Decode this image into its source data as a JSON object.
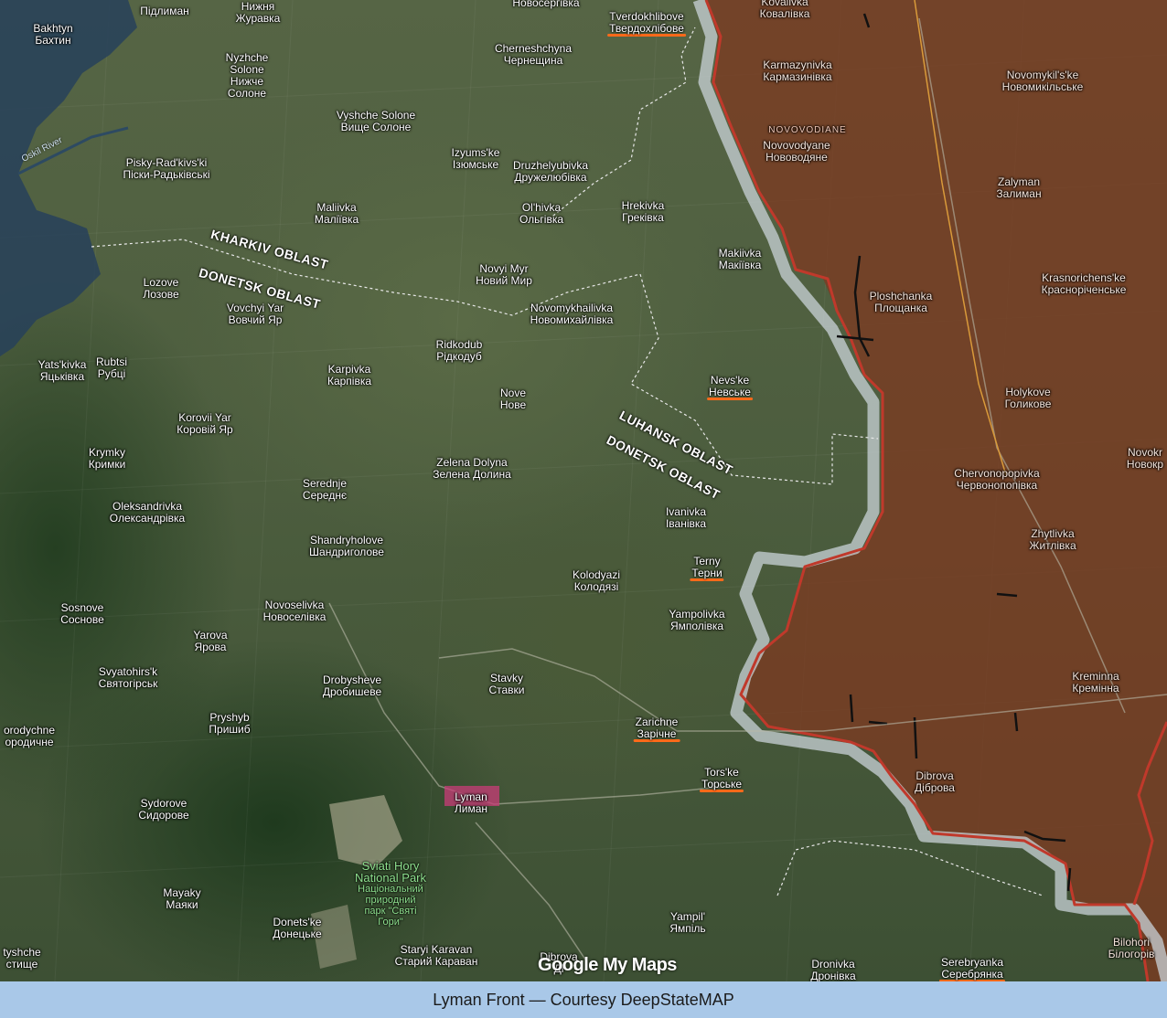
{
  "caption": "Lyman Front — Courtesy DeepStateMAP",
  "watermark": "Google My Maps",
  "colors": {
    "occupied_fill": "#7a3b22",
    "frontline": "#c0392b",
    "grey_zone": "#c9d3d8",
    "front_marker": "#ff6a1a",
    "caption_bg": "#a9c8e8"
  },
  "oblast_labels": {
    "kharkiv": "KHARKIV OBLAST",
    "donetsk_north": "DONETSK OBLAST",
    "luhansk": "LUHANSK OBLAST",
    "donetsk_east": "DONETSK OBLAST"
  },
  "river": "Oskil River",
  "park": {
    "name_en_1": "Sviati Hory",
    "name_en_2": "National Park",
    "name_uk_1": "Національний",
    "name_uk_2": "природний",
    "name_uk_3": "парк \"Святі",
    "name_uk_4": "Гори\""
  },
  "occupied_region_label": "NOVOVODIANE",
  "places": {
    "bakhtyn": {
      "en": "Bakhtyn",
      "uk": "Бахтин"
    },
    "pidlyman": {
      "en": "",
      "uk": "Підлиман"
    },
    "nyzhnia_zhuravka": {
      "en": "Нижня",
      "uk": "Журавка"
    },
    "novoserhivka": {
      "en": "Новосергівка",
      "uk": ""
    },
    "tverdokhlibove": {
      "en": "Tverdokhlibove",
      "uk": "Твердохлібове"
    },
    "kovalivka": {
      "en": "Kovalivka",
      "uk": "Ковалівка"
    },
    "nyzhche_solone": {
      "en": "Nyzhche Solone",
      "uk": "Нижче Солоне"
    },
    "cherneshchyna": {
      "en": "Cherneshchyna",
      "uk": "Чернещина"
    },
    "karmazynivka": {
      "en": "Karmazynivka",
      "uk": "Кармазинівка"
    },
    "novomykilske": {
      "en": "Novomykil's'ke",
      "uk": "Новомикільське"
    },
    "vyshche_solone": {
      "en": "Vyshche Solone",
      "uk": "Вище Солоне"
    },
    "novovodyane": {
      "en": "Novovodyane",
      "uk": "Нововодяне"
    },
    "pisky": {
      "en": "Pisky-Rad'kivs'ki",
      "uk": "Піски-Радьківські"
    },
    "izyumske": {
      "en": "Izyums'ke",
      "uk": "Ізюмське"
    },
    "druzhelyubivka": {
      "en": "Druzhelyubivka",
      "uk": "Дружелюбівка"
    },
    "zalyman": {
      "en": "Zalyman",
      "uk": "Залиман"
    },
    "maliivka": {
      "en": "Maliivka",
      "uk": "Маліївка"
    },
    "olhivka": {
      "en": "Ol'hivka",
      "uk": "Ольгівка"
    },
    "hrekivka": {
      "en": "Hrekivka",
      "uk": "Греківка"
    },
    "makiivka": {
      "en": "Makiivka",
      "uk": "Макіївка"
    },
    "lozove": {
      "en": "Lozove",
      "uk": "Лозове"
    },
    "novyi_myr": {
      "en": "Novyi Myr",
      "uk": "Новий Мир"
    },
    "krasnorichenske": {
      "en": "Krasnorichens'ke",
      "uk": "Красноріченське"
    },
    "ploshchanka": {
      "en": "Ploshchanka",
      "uk": "Площанка"
    },
    "vovchyi_yar": {
      "en": "Vovchyi Yar",
      "uk": "Вовчий Яр"
    },
    "novomykhailivka": {
      "en": "Novomykhailivka",
      "uk": "Новомихайлівка"
    },
    "ridkodub": {
      "en": "Ridkodub",
      "uk": "Рідкодуб"
    },
    "yatskivka": {
      "en": "Yats'kivka",
      "uk": "Яцьківка"
    },
    "rubtsi": {
      "en": "Rubtsi",
      "uk": "Рубці"
    },
    "karpivka": {
      "en": "Karpivka",
      "uk": "Карпівка"
    },
    "nevske": {
      "en": "Nevs'ke",
      "uk": "Невське"
    },
    "holykove": {
      "en": "Holykove",
      "uk": "Голикове"
    },
    "nove": {
      "en": "Nove",
      "uk": "Нове"
    },
    "korovii_yar": {
      "en": "Korovii Yar",
      "uk": "Коровій Яр"
    },
    "krymky": {
      "en": "Krymky",
      "uk": "Кримки"
    },
    "novokr": {
      "en": "Novokr",
      "uk": "Новокр"
    },
    "zelena_dolyna": {
      "en": "Zelena Dolyna",
      "uk": "Зелена Долина"
    },
    "chervonopopivka": {
      "en": "Chervonopopivka",
      "uk": "Червонопопівка"
    },
    "serednje": {
      "en": "Serednje",
      "uk": "Середнє"
    },
    "oleksandrivka": {
      "en": "Oleksandrivka",
      "uk": "Олександрівка"
    },
    "ivanivka": {
      "en": "Ivanivka",
      "uk": "Іванівка"
    },
    "zhytlivka": {
      "en": "Zhytlivka",
      "uk": "Житлівка"
    },
    "shandryholove": {
      "en": "Shandryholove",
      "uk": "Шандриголове"
    },
    "terny": {
      "en": "Terny",
      "uk": "Терни"
    },
    "kolodyazi": {
      "en": "Kolodyazi",
      "uk": "Колодязі"
    },
    "sosnove": {
      "en": "Sosnove",
      "uk": "Соснове"
    },
    "novoselivka": {
      "en": "Novoselivka",
      "uk": "Новоселівка"
    },
    "yampolivka": {
      "en": "Yampolivka",
      "uk": "Ямполівка"
    },
    "yarova": {
      "en": "Yarova",
      "uk": "Ярова"
    },
    "svyatohirsk": {
      "en": "Svyatohirs'k",
      "uk": "Святогірськ"
    },
    "kreminna": {
      "en": "Kreminna",
      "uk": "Кремінна"
    },
    "drobysheve": {
      "en": "Drobysheve",
      "uk": "Дробишеве"
    },
    "stavky": {
      "en": "Stavky",
      "uk": "Ставки"
    },
    "pryshyb": {
      "en": "Pryshyb",
      "uk": "Пришиб"
    },
    "zarichne": {
      "en": "Zarichne",
      "uk": "Зарічне"
    },
    "borodychne": {
      "en": "orodychne",
      "uk": "ородичне"
    },
    "dibrova_e": {
      "en": "Dibrova",
      "uk": "Діброва"
    },
    "torske": {
      "en": "Tors'ke",
      "uk": "Торське"
    },
    "lyman": {
      "en": "Lyman",
      "uk": "Лиман"
    },
    "sydorove": {
      "en": "Sydorove",
      "uk": "Сидорове"
    },
    "mayaky": {
      "en": "Mayaky",
      "uk": "Маяки"
    },
    "yampil": {
      "en": "Yampil'",
      "uk": "Ямпіль"
    },
    "donetske": {
      "en": "Donets'ke",
      "uk": "Донецьке"
    },
    "bilohorivka": {
      "en": "Bilohori",
      "uk": "Білогорів"
    },
    "tyshche": {
      "en": "tyshche",
      "uk": "стище"
    },
    "staryi_karavan": {
      "en": "Staryi Karavan",
      "uk": "Старий Караван"
    },
    "dibrova_s": {
      "en": "Dibrova",
      "uk": "Ді"
    },
    "dronivka": {
      "en": "Dronivka",
      "uk": "Дронівка"
    },
    "serebryanka": {
      "en": "Serebryanka",
      "uk": "Серебрянка"
    }
  }
}
